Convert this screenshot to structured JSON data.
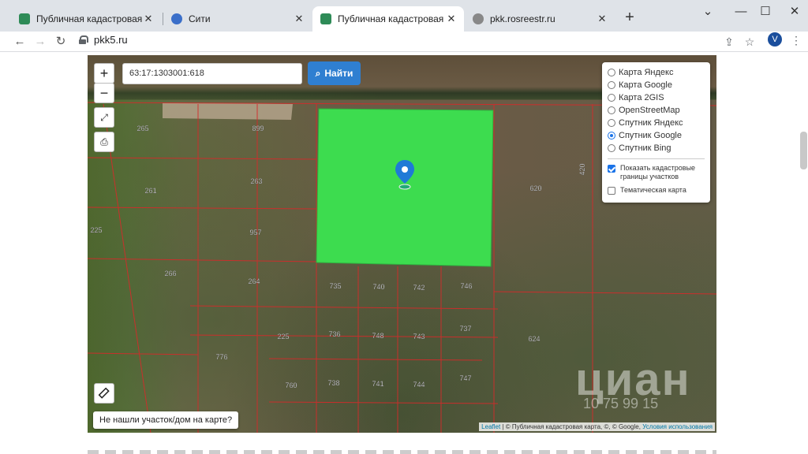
{
  "browser": {
    "tabs": [
      {
        "title": "Публичная кадастровая карта Р",
        "favicon": "green-shield"
      },
      {
        "title": "Сити",
        "favicon": "globe"
      },
      {
        "title": "Публичная кадастровая карта Р",
        "favicon": "green-shield",
        "active": true
      },
      {
        "title": "pkk.rosreestr.ru",
        "favicon": "globe"
      }
    ],
    "new_tab": "+",
    "url": "pkk5.ru",
    "profile_initial": "V"
  },
  "map": {
    "zoom_in": "+",
    "zoom_out": "−",
    "search_value": "63:17:1303001:618",
    "find_button": "Найти",
    "layers": {
      "options": [
        "Карта Яндекс",
        "Карта Google",
        "Карта 2GIS",
        "OpenStreetMap",
        "Спутник Яндекс",
        "Спутник Google",
        "Спутник Bing"
      ],
      "selected": "Спутник Google",
      "show_cadastral": "Показать кадастровые границы участков",
      "thematic": "Тематическая карта"
    },
    "not_found_button": "Не нашли участок/дом на карте?",
    "attribution": {
      "leaflet": "Leaflet",
      "text": "| © Публичная кадастровая карта, ©, © Google,",
      "terms": "Условия использования"
    },
    "watermark": "циан",
    "watermark_id": "10 75 99 15",
    "parcel_labels": [
      "265",
      "899",
      "261",
      "263",
      "225",
      "957",
      "266",
      "264",
      "620",
      "735",
      "740",
      "742",
      "746",
      "225",
      "736",
      "748",
      "743",
      "737",
      "776",
      "624",
      "760",
      "738",
      "741",
      "744",
      "747",
      "420"
    ],
    "highlight_color": "#3ddc4f"
  }
}
